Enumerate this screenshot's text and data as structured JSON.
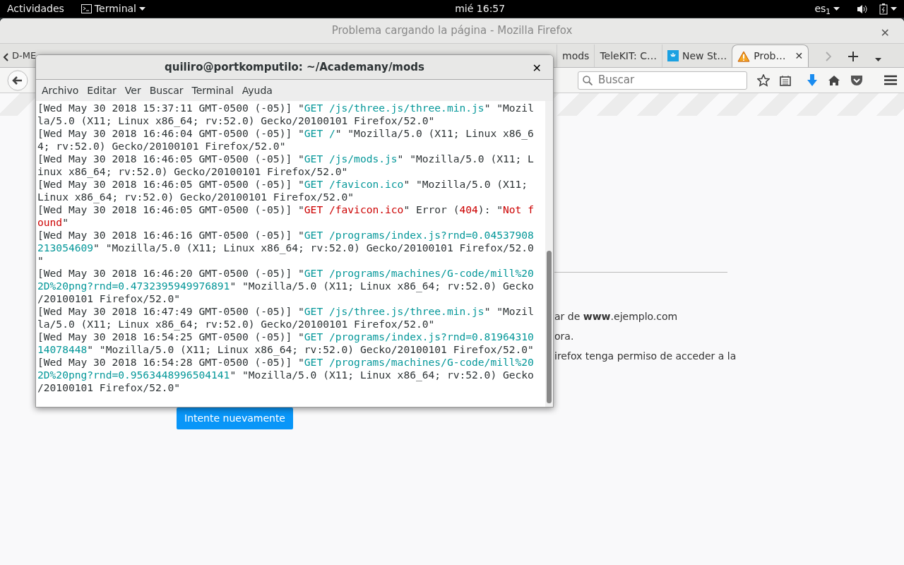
{
  "top_bar": {
    "activities": "Actividades",
    "app_menu": "Terminal",
    "clock": "mié 16:57",
    "input_source": "es$_{1}$"
  },
  "firefox": {
    "title": "Problema cargando la página - Mozilla Firefox",
    "close": "✕",
    "tabs": [
      {
        "label": "D-ME",
        "kind": "plain",
        "selected": false
      },
      {
        "label": "mods",
        "kind": "plain",
        "selected": false
      },
      {
        "label": "TeleKIT: C…",
        "kind": "plain",
        "selected": false
      },
      {
        "label": "New St…",
        "kind": "tile",
        "selected": false
      },
      {
        "label": "Prob…",
        "kind": "warning",
        "selected": true,
        "close": "✕"
      }
    ],
    "search": {
      "placeholder": "Buscar"
    },
    "page": {
      "lines": [
        "ar de **www**.ejemplo.com",
        "ora.",
        "irefox tenga permiso de acceder a la"
      ],
      "retry_button": "Intente nuevamente"
    }
  },
  "terminal": {
    "title": "quiliro@portkomputilo: ~/Academany/mods",
    "close": "✕",
    "menu": [
      "Archivo",
      "Editar",
      "Ver",
      "Buscar",
      "Terminal",
      "Ayuda"
    ],
    "lines": [
      [
        {
          "text": "[Wed May 30 2018 15:37:11 GMT-0500 (-05)] \"",
          "kind": "plain"
        },
        {
          "text": "GET /js/three.js/three.min.js",
          "kind": "url"
        },
        {
          "text": "\" \"Mozil",
          "kind": "plain"
        }
      ],
      [
        {
          "text": "la/5.0 (X11; Linux x86_64; rv:52.0) Gecko/20100101 Firefox/52.0\"",
          "kind": "plain"
        }
      ],
      [
        {
          "text": "[Wed May 30 2018 16:46:04 GMT-0500 (-05)] \"",
          "kind": "plain"
        },
        {
          "text": "GET /",
          "kind": "url"
        },
        {
          "text": "\" \"Mozilla/5.0 (X11; Linux x86_6",
          "kind": "plain"
        }
      ],
      [
        {
          "text": "4; rv:52.0) Gecko/20100101 Firefox/52.0\"",
          "kind": "plain"
        }
      ],
      [
        {
          "text": "[Wed May 30 2018 16:46:05 GMT-0500 (-05)] \"",
          "kind": "plain"
        },
        {
          "text": "GET /js/mods.js",
          "kind": "url"
        },
        {
          "text": "\" \"Mozilla/5.0 (X11; L",
          "kind": "plain"
        }
      ],
      [
        {
          "text": "inux x86_64; rv:52.0) Gecko/20100101 Firefox/52.0\"",
          "kind": "plain"
        }
      ],
      [
        {
          "text": "[Wed May 30 2018 16:46:05 GMT-0500 (-05)] \"",
          "kind": "plain"
        },
        {
          "text": "GET /favicon.ico",
          "kind": "url"
        },
        {
          "text": "\" \"Mozilla/5.0 (X11; ",
          "kind": "plain"
        }
      ],
      [
        {
          "text": "Linux x86_64; rv:52.0) Gecko/20100101 Firefox/52.0\"",
          "kind": "plain"
        }
      ],
      [
        {
          "text": "[Wed May 30 2018 16:46:05 GMT-0500 (-05)] \"",
          "kind": "plain"
        },
        {
          "text": "GET /favicon.ico",
          "kind": "error"
        },
        {
          "text": "\" Error (",
          "kind": "plain"
        },
        {
          "text": "404",
          "kind": "error"
        },
        {
          "text": "): \"",
          "kind": "plain"
        },
        {
          "text": "Not f",
          "kind": "error"
        }
      ],
      [
        {
          "text": "ound",
          "kind": "error"
        },
        {
          "text": "\"",
          "kind": "plain"
        }
      ],
      [
        {
          "text": "[Wed May 30 2018 16:46:16 GMT-0500 (-05)] \"",
          "kind": "plain"
        },
        {
          "text": "GET /programs/index.js?rnd=0.04537908",
          "kind": "url"
        }
      ],
      [
        {
          "text": "213054609",
          "kind": "url"
        },
        {
          "text": "\" \"Mozilla/5.0 (X11; Linux x86_64; rv:52.0) Gecko/20100101 Firefox/52.0",
          "kind": "plain"
        }
      ],
      [
        {
          "text": "\"",
          "kind": "plain"
        }
      ],
      [
        {
          "text": "[Wed May 30 2018 16:46:20 GMT-0500 (-05)] \"",
          "kind": "plain"
        },
        {
          "text": "GET /programs/machines/G-code/mill%20",
          "kind": "url"
        }
      ],
      [
        {
          "text": "2D%20png?rnd=0.4732395949976891",
          "kind": "url"
        },
        {
          "text": "\" \"Mozilla/5.0 (X11; Linux x86_64; rv:52.0) Gecko",
          "kind": "plain"
        }
      ],
      [
        {
          "text": "/20100101 Firefox/52.0\"",
          "kind": "plain"
        }
      ],
      [
        {
          "text": "[Wed May 30 2018 16:47:49 GMT-0500 (-05)] \"",
          "kind": "plain"
        },
        {
          "text": "GET /js/three.js/three.min.js",
          "kind": "url"
        },
        {
          "text": "\" \"Mozil",
          "kind": "plain"
        }
      ],
      [
        {
          "text": "la/5.0 (X11; Linux x86_64; rv:52.0) Gecko/20100101 Firefox/52.0\"",
          "kind": "plain"
        }
      ],
      [
        {
          "text": "[Wed May 30 2018 16:54:25 GMT-0500 (-05)] \"",
          "kind": "plain"
        },
        {
          "text": "GET /programs/index.js?rnd=0.81964310",
          "kind": "url"
        }
      ],
      [
        {
          "text": "14078448",
          "kind": "url"
        },
        {
          "text": "\" \"Mozilla/5.0 (X11; Linux x86_64; rv:52.0) Gecko/20100101 Firefox/52.0\"",
          "kind": "plain"
        }
      ],
      [
        {
          "text": "[Wed May 30 2018 16:54:28 GMT-0500 (-05)] \"",
          "kind": "plain"
        },
        {
          "text": "GET /programs/machines/G-code/mill%20",
          "kind": "url"
        }
      ],
      [
        {
          "text": "2D%20png?rnd=0.9563448996504141",
          "kind": "url"
        },
        {
          "text": "\" \"Mozilla/5.0 (X11; Linux x86_64; rv:52.0) Gecko",
          "kind": "plain"
        }
      ],
      [
        {
          "text": "/20100101 Firefox/52.0\"",
          "kind": "plain"
        }
      ]
    ]
  }
}
